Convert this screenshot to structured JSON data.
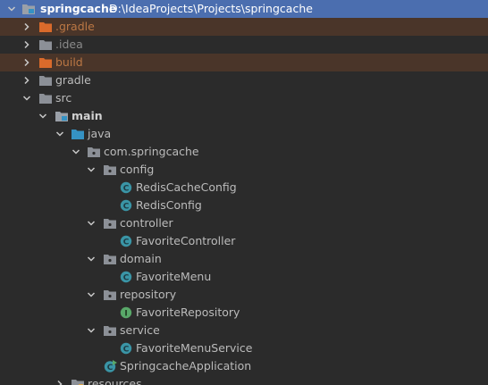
{
  "colors": {
    "selected_bg": "#4b6eaf",
    "excluded_bg": "#4a3529",
    "folder": "#8c9097",
    "excluded_folder": "#d96a2b",
    "source_folder": "#3592c4",
    "class_icon": "#3a95a6",
    "interface_icon": "#59a869"
  },
  "project": {
    "name": "springcache",
    "path": "D:\\IdeaProjects\\Projects\\springcache"
  },
  "tree": {
    "gradle_hidden": ".gradle",
    "idea": ".idea",
    "build": "build",
    "gradle": "gradle",
    "src": "src",
    "main": "main",
    "java": "java",
    "package": "com.springcache",
    "config": "config",
    "redis_cache_config": "RedisCacheConfig",
    "redis_config": "RedisConfig",
    "controller": "controller",
    "favorite_controller": "FavoriteController",
    "domain": "domain",
    "favorite_menu": "FavoriteMenu",
    "repository": "repository",
    "favorite_repository": "FavoriteRepository",
    "service": "service",
    "favorite_menu_service": "FavoriteMenuService",
    "application": "SpringcacheApplication",
    "resources": "resources"
  },
  "icons": {
    "expanded": "chevron-down-icon",
    "collapsed": "chevron-right-icon",
    "folder": "folder-icon",
    "package": "package-icon",
    "class": "class-icon",
    "interface": "interface-icon",
    "app": "spring-boot-class-icon",
    "module": "module-icon"
  },
  "glyphs": {
    "class": "C",
    "interface": "I"
  }
}
